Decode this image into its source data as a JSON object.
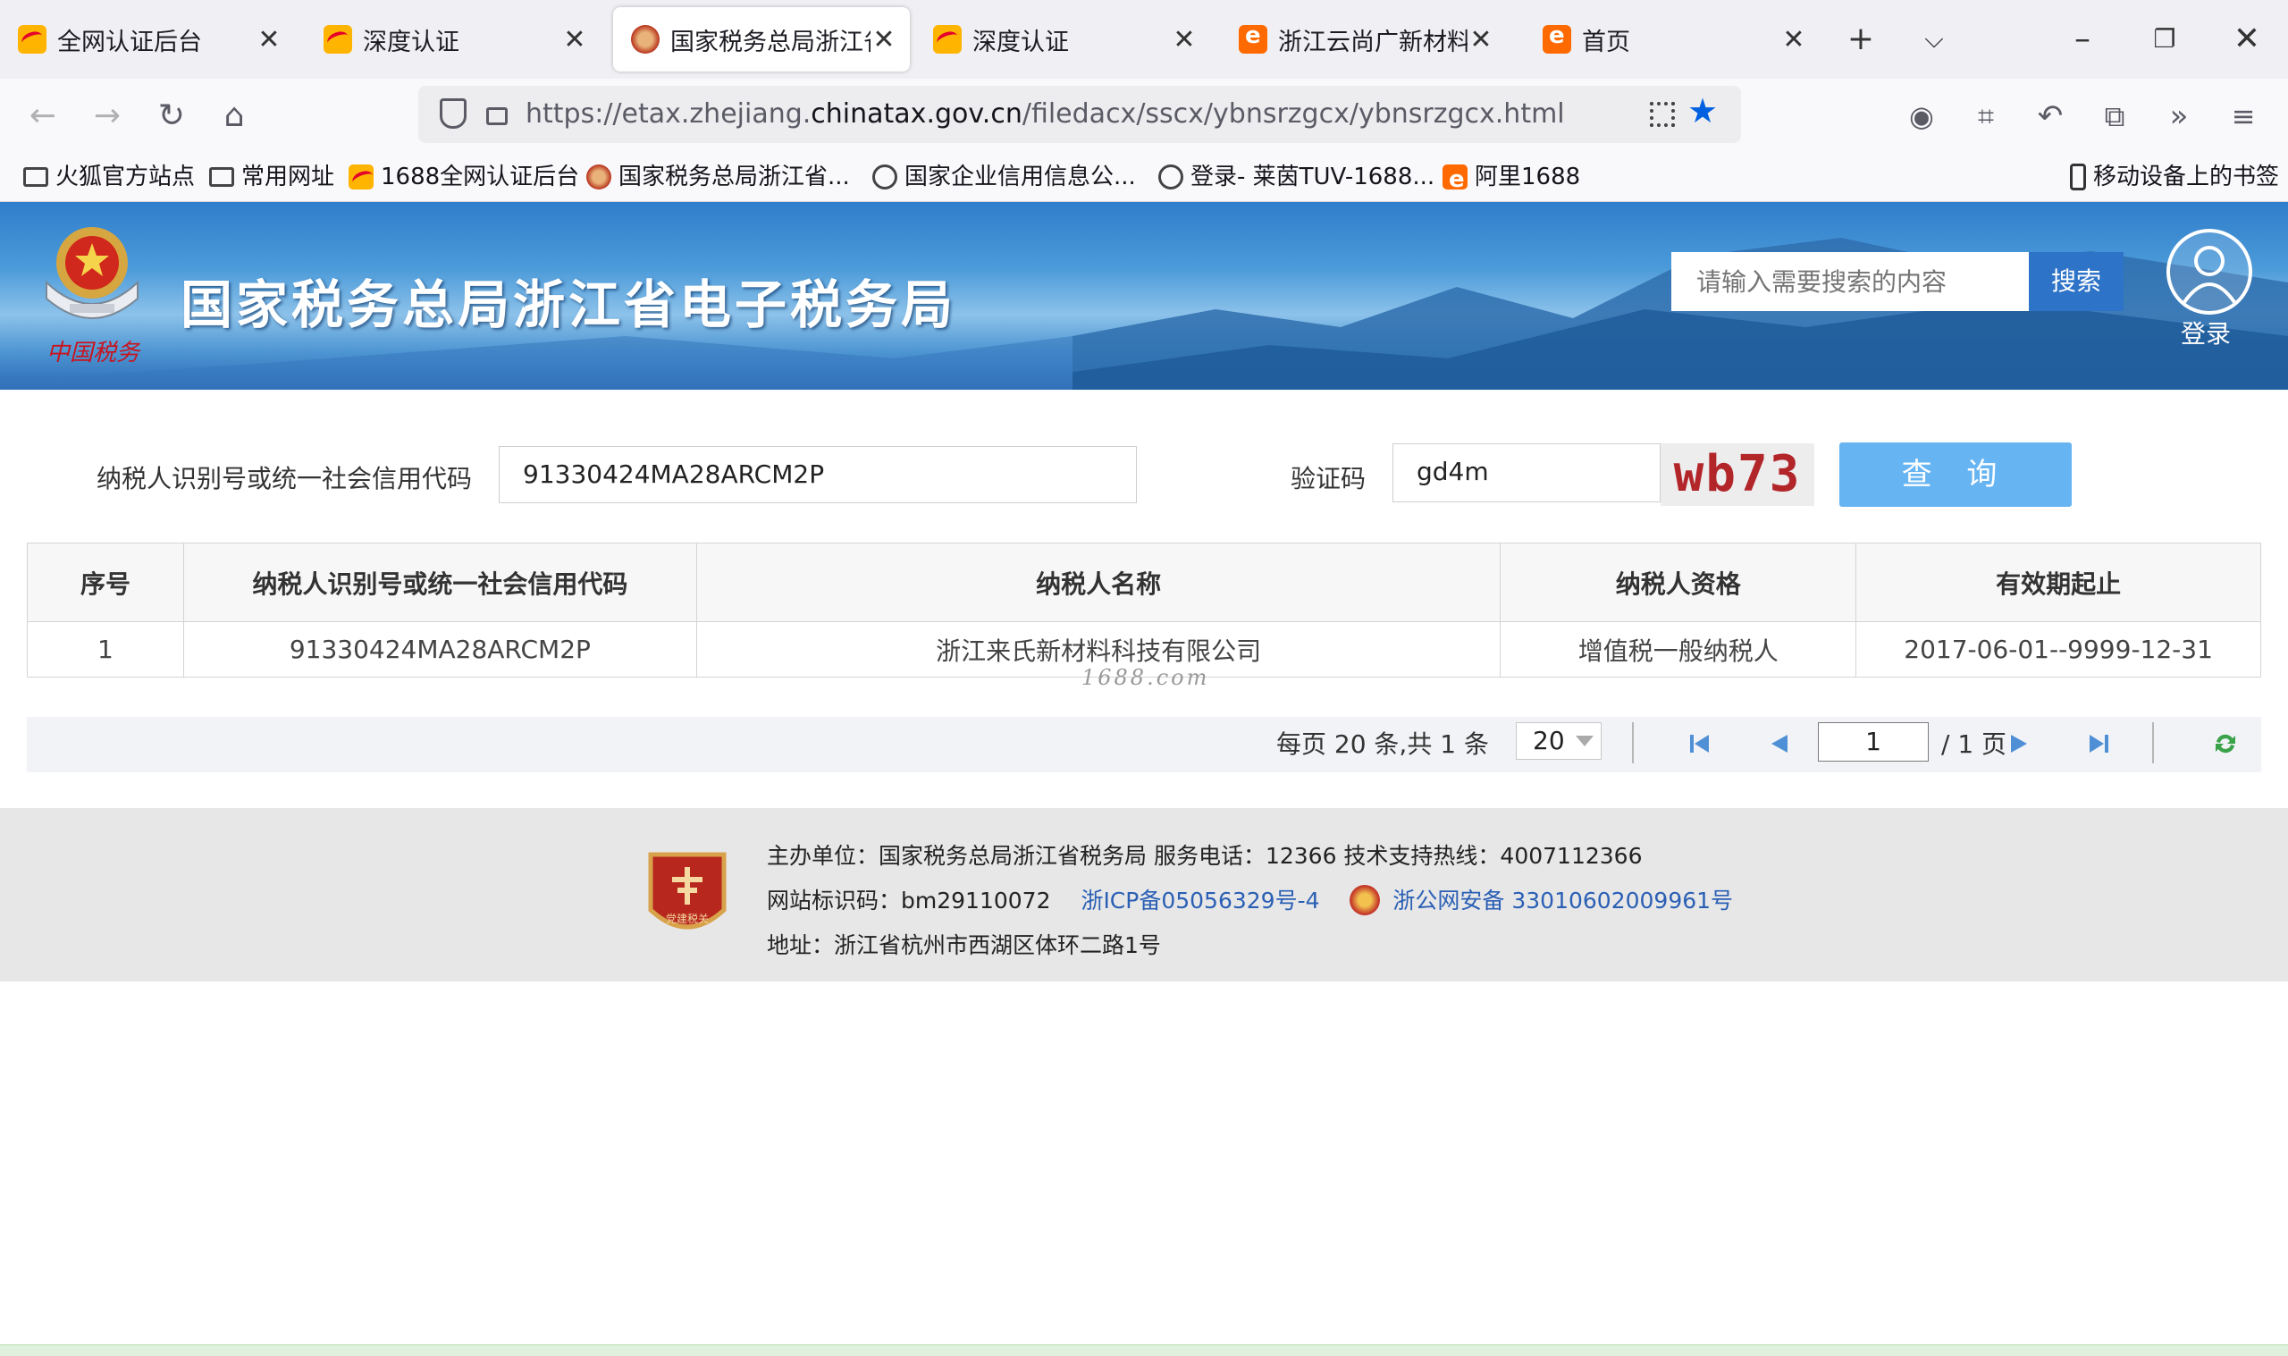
{
  "browser": {
    "tabs": [
      {
        "title": "全网认证后台",
        "icon": "alibaba-1688-icon",
        "active": false
      },
      {
        "title": "深度认证",
        "icon": "alibaba-1688-icon",
        "active": false
      },
      {
        "title": "国家税务总局浙江省电子税务局",
        "icon": "tax-bureau-icon",
        "active": true
      },
      {
        "title": "深度认证",
        "icon": "alibaba-1688-icon",
        "active": false
      },
      {
        "title": "浙江云尚广新材料有限公司",
        "icon": "alibaba-orange-icon",
        "active": false
      },
      {
        "title": "首页",
        "icon": "alibaba-orange-icon",
        "active": false
      }
    ],
    "url": {
      "prefix": "https://etax.zhejiang.",
      "domain": "chinatax.gov.cn",
      "path": "/filedacx/sscx/ybnsrzgcx/ybnsrzgcx.html"
    },
    "bookmarks": [
      {
        "label": "火狐官方站点",
        "icon": "folder-icon"
      },
      {
        "label": "常用网址",
        "icon": "folder-icon"
      },
      {
        "label": "1688全网认证后台",
        "icon": "alibaba-1688-icon"
      },
      {
        "label": "国家税务总局浙江省...",
        "icon": "tax-bureau-icon"
      },
      {
        "label": "国家企业信用信息公...",
        "icon": "globe-icon"
      },
      {
        "label": "登录- 莱茵TUV-1688...",
        "icon": "globe-icon"
      },
      {
        "label": "阿里1688",
        "icon": "alibaba-orange-icon"
      }
    ],
    "mobile_bookmarks": "移动设备上的书签",
    "accent": "#0060df"
  },
  "site": {
    "title": "国家税务总局浙江省电子税务局",
    "slogan": "中国税务",
    "search_placeholder": "请输入需要搜索的内容",
    "search_button": "搜索",
    "login_label": "登录"
  },
  "form": {
    "taxpayer_id_label": "纳税人识别号或统一社会信用代码",
    "taxpayer_id_value": "91330424MA28ARCM2P",
    "captcha_label": "验证码",
    "captcha_value": "gd4m",
    "captcha_image_text": "wb73",
    "query_button": "查 询"
  },
  "table": {
    "headers": [
      "序号",
      "纳税人识别号或统一社会信用代码",
      "纳税人名称",
      "纳税人资格",
      "有效期起止"
    ],
    "rows": [
      [
        "1",
        "91330424MA28ARCM2P",
        "浙江来氏新材料科技有限公司",
        "增值税一般纳税人",
        "2017-06-01--9999-12-31"
      ]
    ],
    "watermark": "1688.com"
  },
  "pager": {
    "summary": "每页 20 条,共 1 条",
    "page_size": "20",
    "current_page": "1",
    "total_pages": "/ 1 页"
  },
  "footer": {
    "badge_text": "党建税关",
    "line1": "主办单位：国家税务总局浙江省税务局    服务电话：12366    技术支持热线：4007112366",
    "site_id": "网站标识码：bm29110072",
    "icp": "浙ICP备05056329号-4",
    "police": "浙公网安备 33010602009961号",
    "address": "地址：浙江省杭州市西湖区体环二路1号"
  },
  "colors": {
    "header_blue": "#2f7ecb",
    "query_button": "#66b4f2",
    "search_button": "#2d73c8",
    "captcha_red": "#b2262a",
    "footer_link": "#2a5fb4"
  }
}
